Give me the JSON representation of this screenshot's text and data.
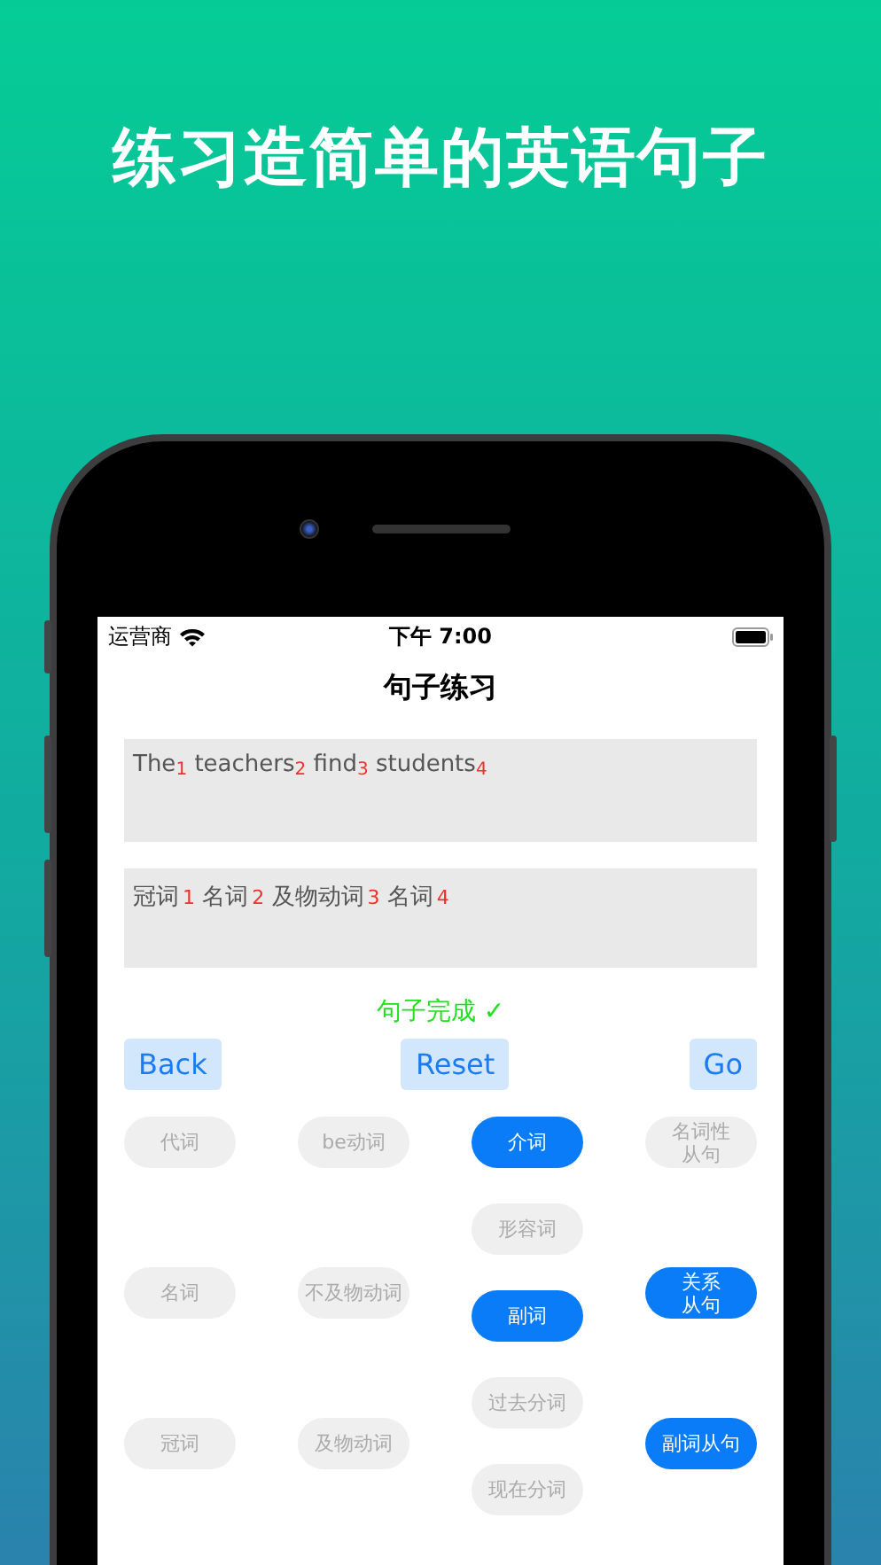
{
  "headline": "练习造简单的英语句子",
  "status_bar": {
    "carrier": "运营商",
    "time": "下午 7:00"
  },
  "title": "句子练习",
  "sentence": [
    {
      "word": "The",
      "index": "1"
    },
    {
      "word": "teachers",
      "index": "2"
    },
    {
      "word": "find",
      "index": "3"
    },
    {
      "word": "students",
      "index": "4"
    }
  ],
  "tags": [
    {
      "word": "冠词",
      "index": "1"
    },
    {
      "word": "名词",
      "index": "2"
    },
    {
      "word": "及物动词",
      "index": "3"
    },
    {
      "word": "名词",
      "index": "4"
    }
  ],
  "status": "句子完成 ✓",
  "buttons": [
    "Back",
    "Reset",
    "Go"
  ],
  "word_columns": [
    [
      {
        "label": "代词",
        "selected": false
      },
      {
        "label": "名词",
        "selected": false
      },
      {
        "label": "冠词",
        "selected": false
      }
    ],
    [
      {
        "label": "be动词",
        "selected": false
      },
      {
        "label": "不及物动词",
        "selected": false
      },
      {
        "label": "及物动词",
        "selected": false
      }
    ],
    [
      {
        "label": "介词",
        "selected": true
      },
      {
        "label": "形容词",
        "selected": false
      },
      {
        "label": "副词",
        "selected": true
      },
      {
        "label": "过去分词",
        "selected": false
      },
      {
        "label": "现在分词",
        "selected": false
      }
    ],
    [
      {
        "lines": [
          "名词性",
          "从句"
        ],
        "selected": false
      },
      {
        "lines": [
          "关系",
          "从句"
        ],
        "selected": true
      },
      {
        "label": "副词从句",
        "selected": true
      }
    ]
  ]
}
